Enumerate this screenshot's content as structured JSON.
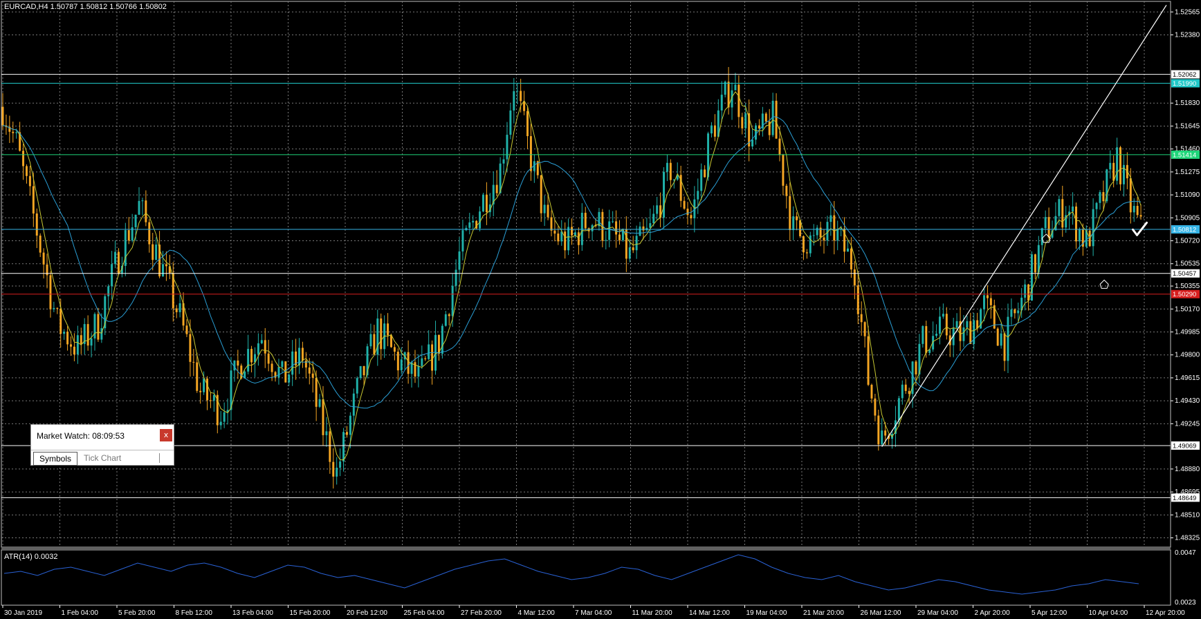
{
  "window": {
    "symbol_info": "EURCAD,H4  1.50787 1.50812 1.50766 1.50802",
    "atr_label": "ATR(14) 0.0032"
  },
  "colors": {
    "background": "#000000",
    "grid": "#7a7a7a",
    "bull_candle": "#20b2aa",
    "bear_candle": "#f5a623",
    "ma_fast": "#c8c832",
    "ma_slow": "#2a9fd6",
    "atr_line": "#2a62d6",
    "trendline": "#ffffff"
  },
  "market_watch": {
    "title": "Market Watch: 08:09:53",
    "close_label": "x",
    "tabs": [
      "Symbols",
      "Tick Chart"
    ]
  },
  "chart_data": {
    "type": "candlestick",
    "symbol": "EURCAD",
    "timeframe": "H4",
    "ylim": [
      1.4825,
      1.5265
    ],
    "price_ticks": [
      "1.52565",
      "1.52380",
      "1.51830",
      "1.51645",
      "1.51460",
      "1.51275",
      "1.51090",
      "1.50905",
      "1.50720",
      "1.50535",
      "1.50355",
      "1.50170",
      "1.49985",
      "1.49800",
      "1.49615",
      "1.49430",
      "1.49245",
      "1.48880",
      "1.48695",
      "1.48510",
      "1.48325"
    ],
    "time_ticks": [
      "30 Jan 2019",
      "1 Feb 04:00",
      "5 Feb 20:00",
      "8 Feb 12:00",
      "13 Feb 04:00",
      "15 Feb 20:00",
      "20 Feb 12:00",
      "25 Feb 04:00",
      "27 Feb 20:00",
      "4 Mar 12:00",
      "7 Mar 04:00",
      "11 Mar 20:00",
      "14 Mar 12:00",
      "19 Mar 04:00",
      "21 Mar 20:00",
      "26 Mar 12:00",
      "29 Mar 04:00",
      "2 Apr 20:00",
      "5 Apr 12:00",
      "10 Apr 04:00",
      "12 Apr 20:00"
    ],
    "horizontal_levels": [
      {
        "price": 1.52062,
        "label": "1.52062",
        "color": "#ffffff"
      },
      {
        "price": 1.5199,
        "label": "1.51990",
        "color": "#1fc8c8"
      },
      {
        "price": 1.51414,
        "label": "1.51414",
        "color": "#1fd67a"
      },
      {
        "price": 1.50812,
        "label": "1.50812",
        "color": "#36b4e6"
      },
      {
        "price": 1.50457,
        "label": "1.50457",
        "color": "#ffffff"
      },
      {
        "price": 1.5029,
        "label": "1.50290",
        "color": "#d81e1e"
      },
      {
        "price": 1.49069,
        "label": "1.49069",
        "color": "#ffffff"
      },
      {
        "price": 1.48649,
        "label": "1.48649",
        "color": "#ffffff"
      }
    ],
    "close_path": [
      [
        0,
        1.518
      ],
      [
        4,
        1.515
      ],
      [
        10,
        1.508
      ],
      [
        16,
        1.5005
      ],
      [
        22,
        1.4985
      ],
      [
        28,
        1.5005
      ],
      [
        34,
        1.506
      ],
      [
        40,
        1.51
      ],
      [
        46,
        1.5055
      ],
      [
        52,
        1.501
      ],
      [
        58,
        1.495
      ],
      [
        64,
        1.4935
      ],
      [
        70,
        1.4975
      ],
      [
        76,
        1.4995
      ],
      [
        82,
        1.496
      ],
      [
        88,
        1.498
      ],
      [
        94,
        1.492
      ],
      [
        98,
        1.4885
      ],
      [
        104,
        1.495
      ],
      [
        110,
        1.5
      ],
      [
        116,
        1.4975
      ],
      [
        122,
        1.496
      ],
      [
        128,
        1.499
      ],
      [
        134,
        1.506
      ],
      [
        140,
        1.51
      ],
      [
        146,
        1.513
      ],
      [
        150,
        1.52
      ],
      [
        154,
        1.515
      ],
      [
        160,
        1.508
      ],
      [
        166,
        1.507
      ],
      [
        172,
        1.509
      ],
      [
        178,
        1.508
      ],
      [
        184,
        1.506
      ],
      [
        190,
        1.508
      ],
      [
        196,
        1.513
      ],
      [
        202,
        1.509
      ],
      [
        208,
        1.516
      ],
      [
        214,
        1.52
      ],
      [
        220,
        1.515
      ],
      [
        226,
        1.517
      ],
      [
        232,
        1.508
      ],
      [
        238,
        1.507
      ],
      [
        244,
        1.508
      ],
      [
        250,
        1.505
      ],
      [
        254,
        1.496
      ],
      [
        258,
        1.491
      ],
      [
        264,
        1.495
      ],
      [
        270,
        1.499
      ],
      [
        276,
        1.5
      ],
      [
        282,
        1.4995
      ],
      [
        288,
        1.502
      ],
      [
        294,
        1.499
      ],
      [
        300,
        1.503
      ],
      [
        306,
        1.508
      ],
      [
        312,
        1.51
      ],
      [
        318,
        1.507
      ],
      [
        322,
        1.51
      ],
      [
        327,
        1.514
      ],
      [
        331,
        1.51
      ],
      [
        334,
        1.508
      ]
    ],
    "atr_ylim": [
      0.0023,
      0.0047
    ],
    "atr_ticks": [
      "0.0047",
      "0.0023"
    ],
    "atr_values": [
      0.0037,
      0.0038,
      0.0036,
      0.0039,
      0.004,
      0.0038,
      0.0036,
      0.0039,
      0.0042,
      0.004,
      0.0038,
      0.0041,
      0.0042,
      0.004,
      0.0037,
      0.0035,
      0.0038,
      0.0041,
      0.004,
      0.0037,
      0.0035,
      0.0036,
      0.0034,
      0.0032,
      0.003,
      0.0033,
      0.0036,
      0.0039,
      0.0041,
      0.0043,
      0.0044,
      0.0041,
      0.0038,
      0.0036,
      0.0034,
      0.0035,
      0.0037,
      0.004,
      0.0039,
      0.0036,
      0.0034,
      0.0037,
      0.004,
      0.0043,
      0.0046,
      0.0044,
      0.004,
      0.0037,
      0.0035,
      0.0034,
      0.0036,
      0.0033,
      0.0031,
      0.0029,
      0.003,
      0.0032,
      0.0034,
      0.0033,
      0.0031,
      0.0029,
      0.0028,
      0.0027,
      0.0028,
      0.0029,
      0.0031,
      0.0032,
      0.0034,
      0.0033,
      0.0032
    ]
  }
}
